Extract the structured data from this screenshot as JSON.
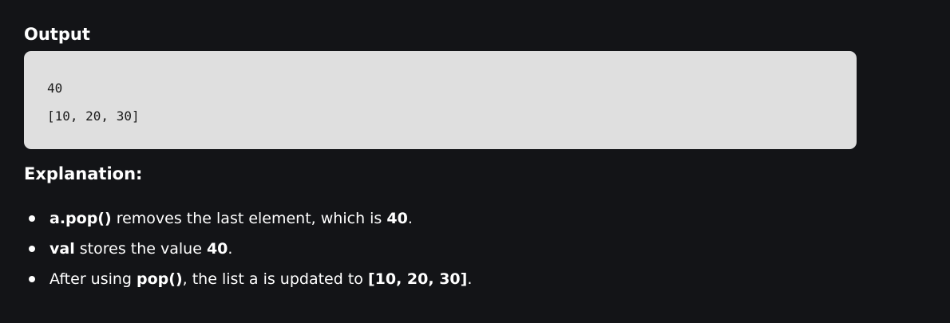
{
  "output": {
    "heading": "Output",
    "lines": [
      "40",
      "[10, 20, 30]"
    ]
  },
  "explanation": {
    "heading": "Explanation:",
    "bullets": [
      {
        "bold1": "a.pop()",
        "text1": " removes the last element, which is ",
        "bold2": "40",
        "text2": "."
      },
      {
        "bold1": "val",
        "text1": " stores the value ",
        "bold2": "40",
        "text2": "."
      },
      {
        "text0": "After using ",
        "bold1": "pop()",
        "text1": ", the list a is updated to ",
        "bold2": "[10, 20, 30]",
        "text2": "."
      }
    ]
  },
  "colors": {
    "background": "#131417",
    "code_background": "#dfdfdf",
    "text": "#ffffff"
  }
}
